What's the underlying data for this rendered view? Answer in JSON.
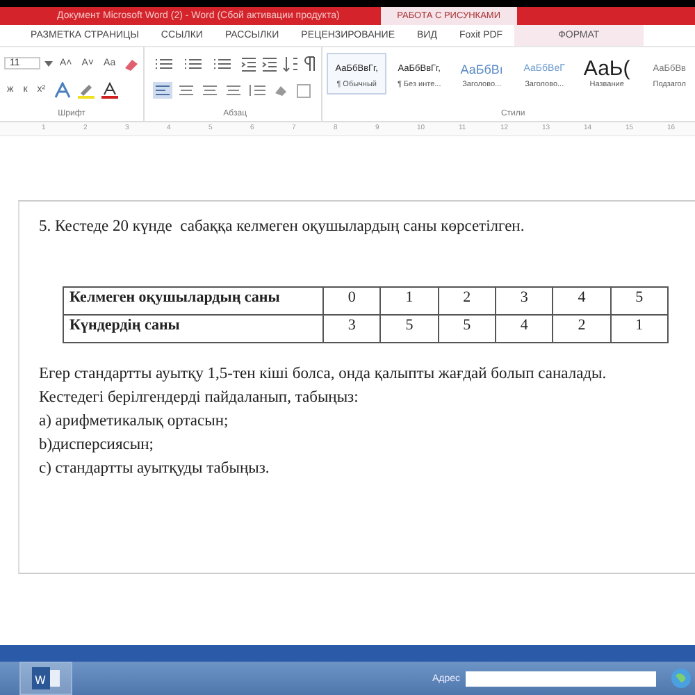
{
  "window": {
    "title": "Документ Microsoft Word (2) - Word (Сбой активации продукта)",
    "context_group": "РАБОТА С РИСУНКАМИ"
  },
  "tabs": [
    {
      "label": "РАЗМЕТКА СТРАНИЦЫ",
      "kind": "normal"
    },
    {
      "label": "ССЫЛКИ",
      "kind": "normal"
    },
    {
      "label": "РАССЫЛКИ",
      "kind": "normal"
    },
    {
      "label": "РЕЦЕНЗИРОВАНИЕ",
      "kind": "normal"
    },
    {
      "label": "ВИД",
      "kind": "normal"
    },
    {
      "label": "Foxit PDF",
      "kind": "normal"
    },
    {
      "label": "ФОРМАТ",
      "kind": "contextual"
    }
  ],
  "ribbon": {
    "font_size": "11",
    "font_buttons": [
      "A˄",
      "A˅",
      "Aa"
    ],
    "format_buttons": [
      "ж",
      "к",
      "x²"
    ],
    "groups": [
      "Шрифт",
      "Абзац",
      "Стили"
    ],
    "styles": [
      {
        "sample": "АаБбВвГг,",
        "name": "¶ Обычный",
        "selected": true,
        "kind": "body"
      },
      {
        "sample": "АаБбВвГг,",
        "name": "¶ Без инте...",
        "selected": false,
        "kind": "body"
      },
      {
        "sample": "АаБбВı",
        "name": "Заголово...",
        "selected": false,
        "kind": "heading1"
      },
      {
        "sample": "АаБбВеГ",
        "name": "Заголово...",
        "selected": false,
        "kind": "heading2"
      },
      {
        "sample": "АаЬ(",
        "name": "Название",
        "selected": false,
        "kind": "title"
      },
      {
        "sample": "АаБбВв",
        "name": "Подзагол",
        "selected": false,
        "kind": "subtitle"
      }
    ]
  },
  "ruler": [
    "1",
    "2",
    "3",
    "4",
    "5",
    "6",
    "7",
    "8",
    "9",
    "10",
    "11",
    "12",
    "13",
    "14",
    "15",
    "16"
  ],
  "document": {
    "heading": "5. Кестеде 20 күнде  сабаққа келмеген оқушылардың саны көрсетілген.",
    "table": {
      "rows": [
        {
          "cells": [
            "Келмеген оқушылардың саны",
            "0",
            "1",
            "2",
            "3",
            "4",
            "5"
          ]
        },
        {
          "cells": [
            "Күндердің саны",
            "3",
            "5",
            "5",
            "4",
            "2",
            "1"
          ]
        }
      ]
    },
    "paragraphs": [
      "Егер стандартты ауытқу 1,5-тен кіші болса, онда қалыпты жағдай болып саналады. Кестедегі берілгендерді пайдаланып, табыңыз:",
      "a) арифметикалық ортасын;",
      "b)дисперсиясын;",
      "c) стандартты ауытқуды табыңыз."
    ]
  },
  "taskbar": {
    "address_label": "Адрес",
    "app_letter": "W"
  }
}
